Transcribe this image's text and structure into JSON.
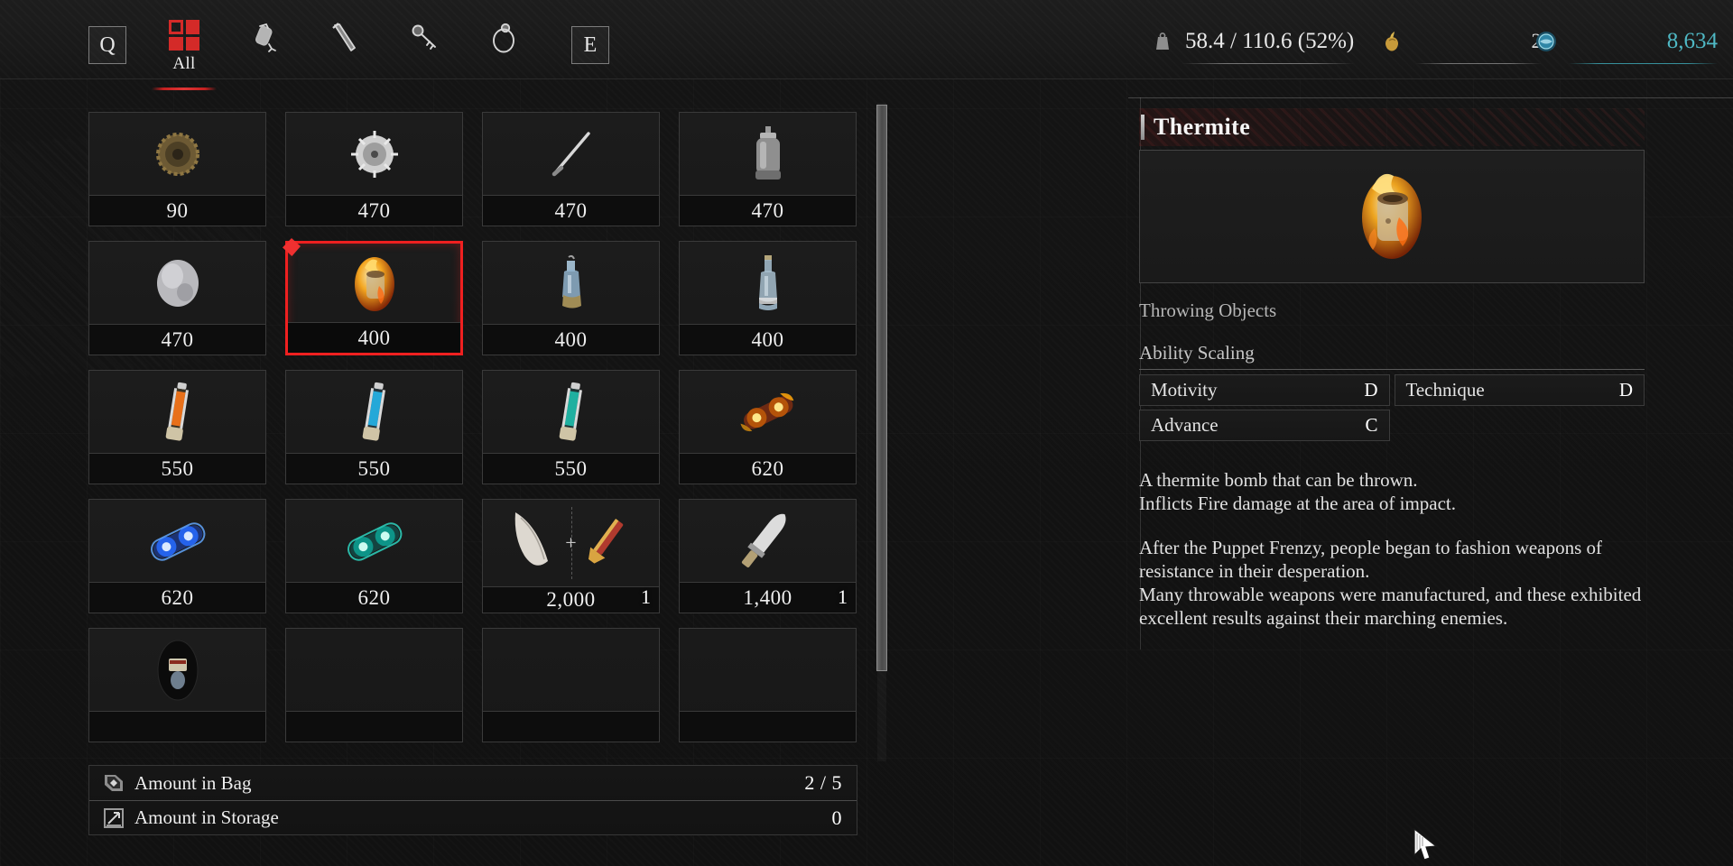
{
  "topbar": {
    "prev_key": "Q",
    "next_key": "E",
    "categories": [
      {
        "id": "all",
        "label": "All",
        "icon": "grid-2x2-icon",
        "active": true
      },
      {
        "id": "consumable",
        "label": "",
        "icon": "grenade-icon",
        "active": false
      },
      {
        "id": "weapon",
        "label": "",
        "icon": "dagger-icon",
        "active": false
      },
      {
        "id": "tool",
        "label": "",
        "icon": "key-icon",
        "active": false
      },
      {
        "id": "misc",
        "label": "",
        "icon": "ring-icon",
        "active": false
      }
    ],
    "stats": {
      "weight": {
        "icon": "weight-icon",
        "value": "58.4 / 110.6 (52%)"
      },
      "flask": {
        "icon": "flask-icon",
        "value": "2"
      },
      "currency": {
        "icon": "orb-icon",
        "value": "8,634",
        "color": "#4fb8c4"
      }
    }
  },
  "inventory": {
    "columns": 4,
    "scrollbar": {
      "visible": true,
      "thumb_position": "top"
    },
    "slots": [
      {
        "art": "bronze-gear-icon",
        "price": "90",
        "qty": "",
        "selected": false,
        "empty": false
      },
      {
        "art": "saw-blade-icon",
        "price": "470",
        "qty": "",
        "selected": false,
        "empty": false
      },
      {
        "art": "needle-icon",
        "price": "470",
        "qty": "",
        "selected": false,
        "empty": false
      },
      {
        "art": "metal-canister-icon",
        "price": "470",
        "qty": "",
        "selected": false,
        "empty": false
      },
      {
        "art": "silver-stone-icon",
        "price": "470",
        "qty": "",
        "selected": false,
        "empty": false
      },
      {
        "art": "thermite-icon",
        "price": "400",
        "qty": "",
        "selected": true,
        "empty": false
      },
      {
        "art": "blue-flask-icon",
        "price": "400",
        "qty": "",
        "selected": false,
        "empty": false
      },
      {
        "art": "glass-bottle-icon",
        "price": "400",
        "qty": "",
        "selected": false,
        "empty": false
      },
      {
        "art": "orange-vial-icon",
        "price": "550",
        "qty": "",
        "selected": false,
        "empty": false
      },
      {
        "art": "blue-vial-icon",
        "price": "550",
        "qty": "",
        "selected": false,
        "empty": false
      },
      {
        "art": "teal-vial-icon",
        "price": "550",
        "qty": "",
        "selected": false,
        "empty": false
      },
      {
        "art": "fire-amulet-icon",
        "price": "620",
        "qty": "",
        "selected": false,
        "empty": false
      },
      {
        "art": "blue-amulet-icon",
        "price": "620",
        "qty": "",
        "selected": false,
        "empty": false
      },
      {
        "art": "teal-amulet-icon",
        "price": "620",
        "qty": "",
        "selected": false,
        "empty": false
      },
      {
        "art": "feather-and-blade-icon",
        "price": "2,000",
        "qty": "1",
        "selected": false,
        "empty": false
      },
      {
        "art": "silver-blade-icon",
        "price": "1,400",
        "qty": "1",
        "selected": false,
        "empty": false
      },
      {
        "art": "vinyl-record-icon",
        "price": "",
        "qty": "",
        "selected": false,
        "empty": false
      },
      {
        "art": "",
        "price": "",
        "qty": "",
        "selected": false,
        "empty": true
      },
      {
        "art": "",
        "price": "",
        "qty": "",
        "selected": false,
        "empty": true
      },
      {
        "art": "",
        "price": "",
        "qty": "",
        "selected": false,
        "empty": true
      }
    ]
  },
  "amount_panel": {
    "rows": [
      {
        "icon": "bag-icon",
        "label": "Amount in Bag",
        "value": "2 / 5"
      },
      {
        "icon": "storage-icon",
        "label": "Amount in Storage",
        "value": "0"
      }
    ]
  },
  "detail": {
    "title": "Thermite",
    "art": "thermite-icon",
    "type": "Throwing Objects",
    "scaling_label": "Ability Scaling",
    "scaling": [
      {
        "name": "Motivity",
        "grade": "D"
      },
      {
        "name": "Technique",
        "grade": "D"
      },
      {
        "name": "Advance",
        "grade": "C"
      }
    ],
    "description": [
      "A thermite bomb that can be thrown.",
      "Inflicts Fire damage at the area of impact."
    ],
    "lore": [
      "After the Puppet Frenzy, people began to fashion weapons of resistance in their desperation.",
      "Many throwable weapons were manufactured, and these exhibited excellent results against their marching enemies."
    ]
  },
  "cursor": {
    "icon": "arrow-cursor-icon"
  },
  "colors": {
    "accent_red": "#d42a28",
    "selection_red": "#ef2020",
    "currency_teal": "#4fb8c4",
    "panel_bg": "#181818"
  }
}
